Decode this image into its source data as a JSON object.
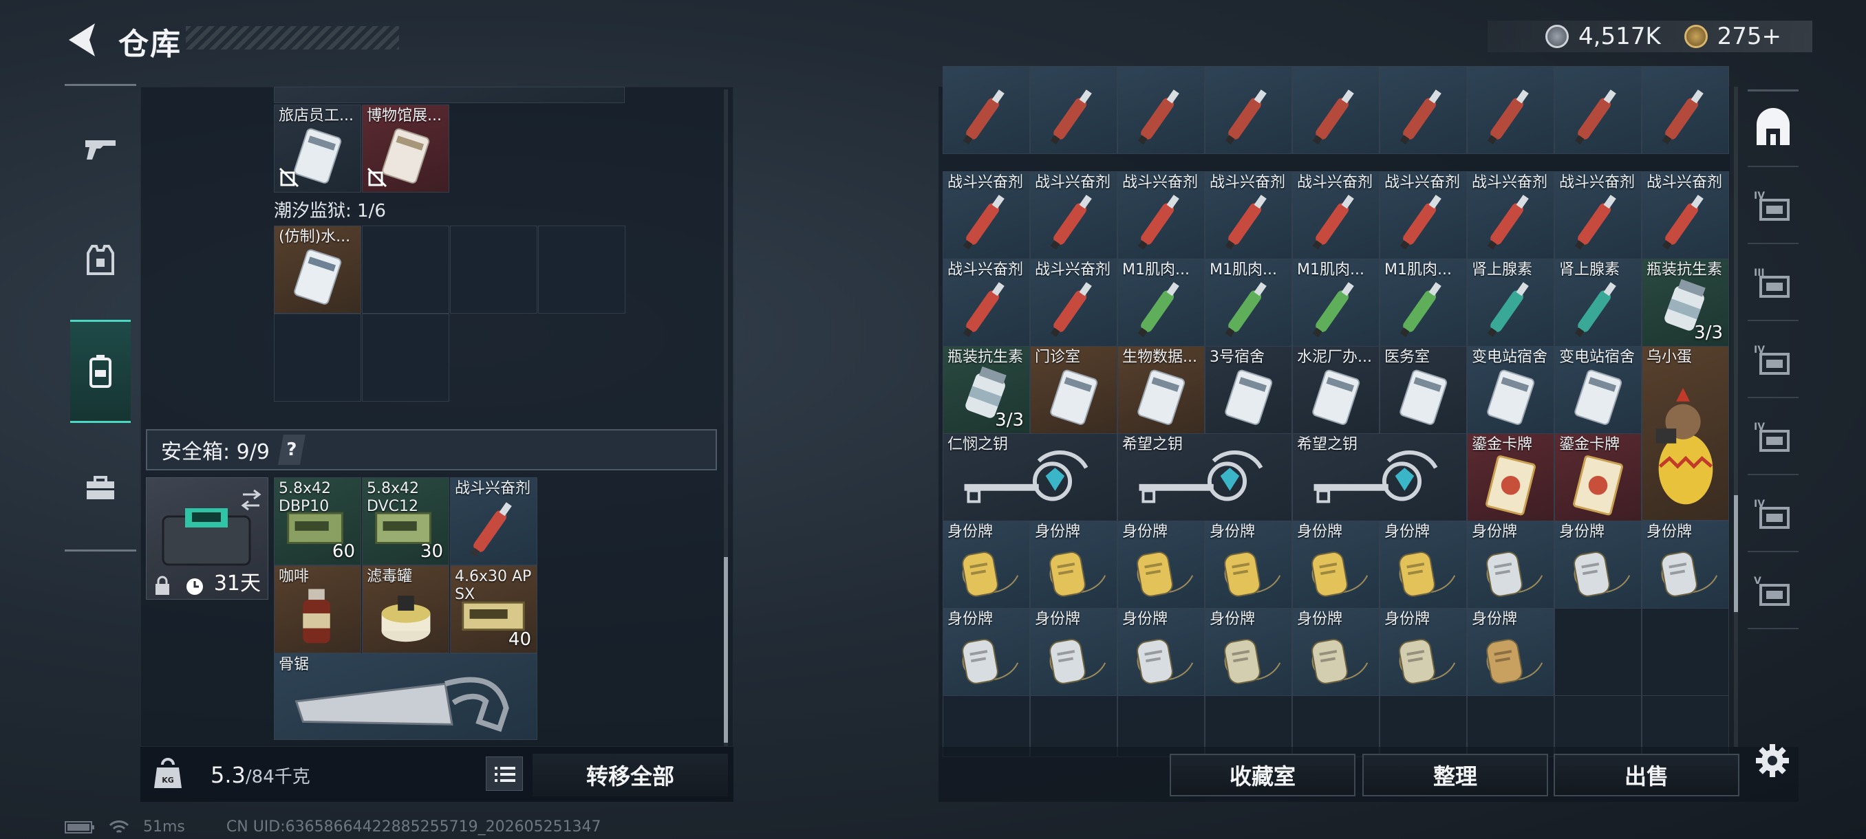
{
  "header": {
    "title": "仓库"
  },
  "currency": {
    "silver": "4,517K",
    "gold": "275+"
  },
  "sidebar": [
    {
      "name": "weapons-tab",
      "icon": "gun-icon"
    },
    {
      "name": "armor-tab",
      "icon": "armor-icon"
    },
    {
      "name": "backpack-tab",
      "icon": "backpack-icon",
      "active": true
    },
    {
      "name": "case-tab",
      "icon": "toolbox-icon"
    }
  ],
  "left": {
    "top_cards": [
      "旅店员工...",
      "博物馆展..."
    ],
    "prison_label": "潮汐监狱: 1/6",
    "prison_card": "(仿制)水...",
    "safebox_label": "安全箱: 9/9",
    "safebox_help": "?",
    "safebox_days": "31天",
    "safebox_items": [
      {
        "label": "5.8x42 DBP10",
        "count": "60"
      },
      {
        "label": "5.8x42 DVC12",
        "count": "30"
      },
      {
        "label": "战斗兴奋剂",
        "count": ""
      },
      {
        "label": "咖啡",
        "count": ""
      },
      {
        "label": "滤毒罐",
        "count": ""
      },
      {
        "label": "4.6x30 AP SX",
        "count": "40"
      },
      {
        "label": "骨锯",
        "count": ""
      }
    ],
    "weight_current": "5.3",
    "weight_max": "/84千克",
    "transfer_all": "转移全部"
  },
  "right": {
    "rows": [
      [
        "",
        "",
        "",
        "",
        "",
        "",
        "",
        "",
        ""
      ],
      [
        "战斗兴奋剂",
        "战斗兴奋剂",
        "战斗兴奋剂",
        "战斗兴奋剂",
        "战斗兴奋剂",
        "战斗兴奋剂",
        "战斗兴奋剂",
        "战斗兴奋剂",
        "战斗兴奋剂"
      ],
      [
        "战斗兴奋剂",
        "战斗兴奋剂",
        "M1肌肉...",
        "M1肌肉...",
        "M1肌肉...",
        "M1肌肉...",
        "肾上腺素",
        "肾上腺素",
        "瓶装抗生素"
      ],
      [
        "瓶装抗生素",
        "门诊室",
        "生物数据...",
        "3号宿舍",
        "水泥厂办...",
        "医务室",
        "变电站宿舍",
        "变电站宿舍"
      ],
      [
        "身份牌",
        "身份牌",
        "身份牌",
        "身份牌",
        "身份牌",
        "身份牌",
        "身份牌",
        "身份牌",
        "身份牌"
      ],
      [
        "身份牌",
        "身份牌",
        "身份牌",
        "身份牌",
        "身份牌",
        "身份牌",
        "身份牌"
      ]
    ],
    "wide_items": [
      "仁悯之钥",
      "希望之钥",
      "希望之钥",
      "鎏金卡牌",
      "鎏金卡牌"
    ],
    "tall_item": "乌小蛋",
    "antibiotic_count": "3/3",
    "buttons": {
      "collection": "收藏室",
      "sort": "整理",
      "sell": "出售"
    }
  },
  "right_nav": [
    "home-icon",
    "level4-folder-icon",
    "level3-case-icon",
    "level4-armor-icon",
    "level4-key-icon",
    "level4-gun-icon",
    "level5-gun-icon"
  ],
  "status": {
    "ping": "51ms",
    "uid": "CN UID:6365866442288525571​9_202605251347"
  }
}
